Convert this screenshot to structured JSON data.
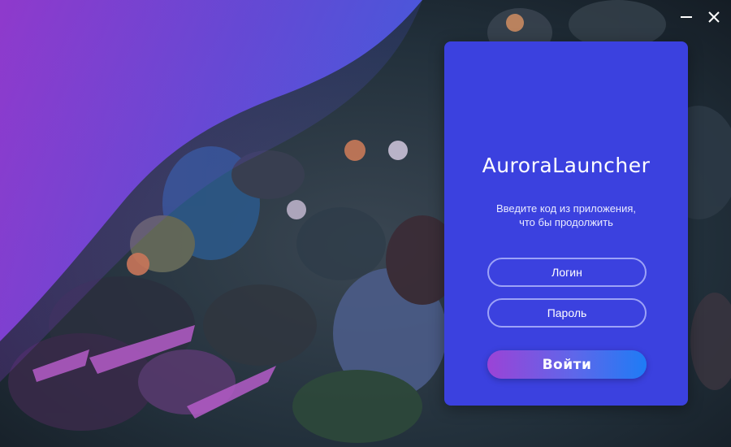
{
  "app": {
    "title": "AuroraLauncher"
  },
  "window_controls": [
    {
      "icon": "minimize-icon"
    },
    {
      "icon": "close-icon"
    }
  ],
  "auth_panel": {
    "prompt_line1": "Введите код из приложения,",
    "prompt_line2": "что бы продолжить",
    "login_placeholder": "Логин",
    "password_placeholder": "Пароль",
    "submit_label": "Войти"
  },
  "colors": {
    "panel": "#3b41df",
    "accent_gradient_start": "#9b43d6",
    "accent_gradient_end": "#1e7cf5",
    "wave_purple": "#9a3ad8",
    "wave_blue": "#4a5ae6"
  }
}
